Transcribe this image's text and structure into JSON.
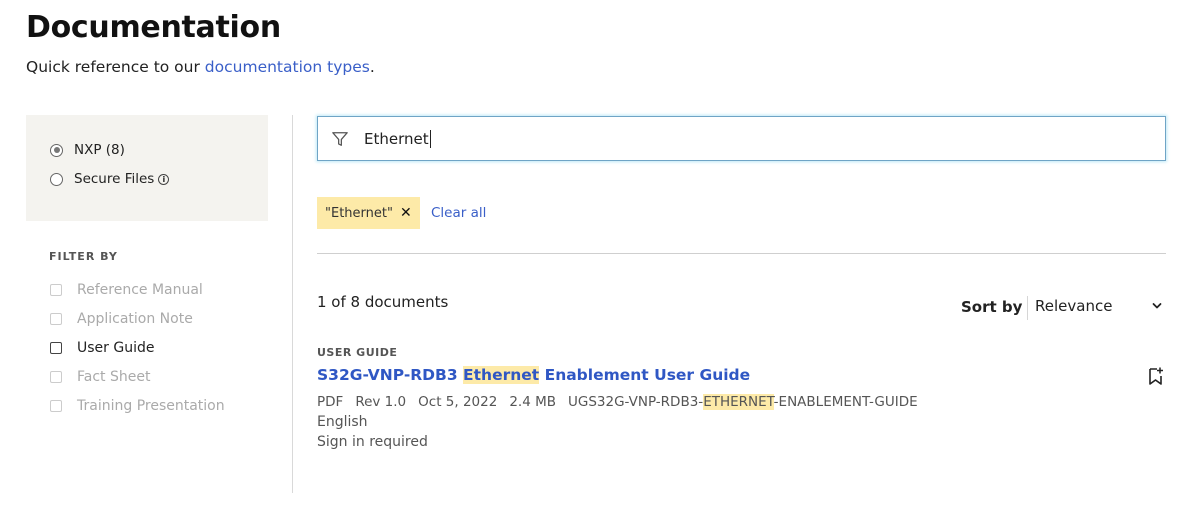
{
  "header": {
    "title": "Documentation",
    "subtitle_prefix": "Quick reference to our ",
    "subtitle_link": "documentation types",
    "subtitle_suffix": "."
  },
  "scope": {
    "options": [
      {
        "label": "NXP (8)",
        "checked": true
      },
      {
        "label": "Secure Files",
        "checked": false,
        "info_icon": "info-icon"
      }
    ]
  },
  "filters": {
    "heading": "FILTER BY",
    "items": [
      {
        "label": "Reference Manual",
        "enabled": false
      },
      {
        "label": "Application Note",
        "enabled": false
      },
      {
        "label": "User Guide",
        "enabled": true
      },
      {
        "label": "Fact Sheet",
        "enabled": false
      },
      {
        "label": "Training Presentation",
        "enabled": false
      }
    ]
  },
  "search": {
    "icon": "filter-icon",
    "value": "Ethernet"
  },
  "active_filters": {
    "chip_label": "\"Ethernet\"",
    "chip_close": "✕",
    "clear_all": "Clear all"
  },
  "results": {
    "count_text": "1 of 8 documents",
    "sort_label": "Sort by",
    "sort_value": "Relevance",
    "items": [
      {
        "type": "USER GUIDE",
        "title_prefix": "S32G-VNP-RDB3 ",
        "title_highlight": "Ethernet",
        "title_suffix": " Enablement User Guide",
        "format": "PDF",
        "revision": "Rev 1.0",
        "date": "Oct 5, 2022",
        "size": "2.4 MB",
        "id_prefix": "UGS32G-VNP-RDB3-",
        "id_highlight": "ETHERNET",
        "id_suffix": "-ENABLEMENT-GUIDE",
        "language": "English",
        "access": "Sign in required",
        "bookmark_icon": "bookmark-add-icon"
      }
    ]
  },
  "colors": {
    "link": "#3a5fc8",
    "highlight": "#fdeaa8",
    "panel_bg": "#f4f3ef"
  }
}
